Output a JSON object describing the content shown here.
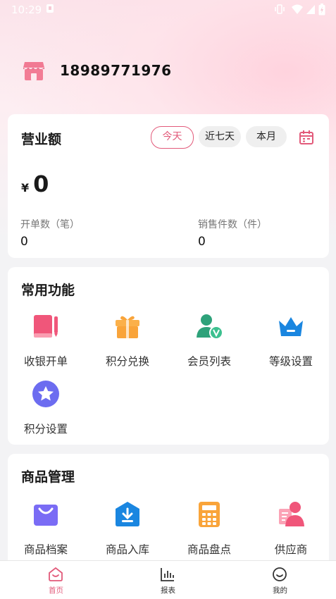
{
  "status_bar": {
    "time": "10:29"
  },
  "header": {
    "phone": "18989771976"
  },
  "revenue": {
    "title": "营业额",
    "periods": [
      "今天",
      "近七天",
      "本月"
    ],
    "selected_period": "今天",
    "currency": "¥",
    "amount": "0",
    "stats": [
      {
        "label": "开单数（笔）",
        "value": "0"
      },
      {
        "label": "销售件数（件）",
        "value": "0"
      }
    ]
  },
  "common": {
    "title": "常用功能",
    "items": [
      "收银开单",
      "积分兑换",
      "会员列表",
      "等级设置",
      "积分设置"
    ]
  },
  "goods": {
    "title": "商品管理",
    "items": [
      "商品档案",
      "商品入库",
      "商品盘点",
      "供应商"
    ]
  },
  "tabbar": {
    "items": [
      "首页",
      "报表",
      "我的"
    ],
    "active": "首页"
  },
  "colors": {
    "accent": "#e25a7a",
    "page_bg": "#f3f3f5"
  }
}
